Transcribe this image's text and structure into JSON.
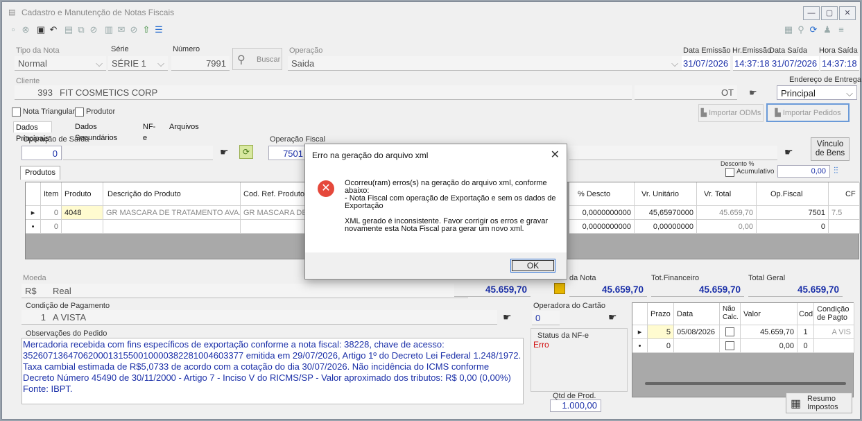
{
  "window": {
    "title": "Cadastro e Manutenção de Notas Fiscais",
    "app_icon": "form-icon"
  },
  "header": {
    "tipo_label": "Tipo da Nota",
    "tipo_value": "Normal",
    "serie_label": "Série",
    "serie_value": "SÉRIE 1",
    "numero_label": "Número",
    "numero_value": "7991",
    "buscar_label": "Buscar",
    "operacao_label": "Operação",
    "operacao_value": "Saida",
    "data_emissao_label": "Data Emissão",
    "data_emissao_value": "31/07/2026",
    "hr_emissao_label": "Hr.Emissão",
    "hr_emissao_value": "14:37:18",
    "data_saida_label": "Data Saída",
    "data_saida_value": "31/07/2026",
    "hora_saida_label": "Hora Saída",
    "hora_saida_value": "14:37:18"
  },
  "cliente": {
    "label": "Cliente",
    "code": "393",
    "name": "FIT COSMETICS CORP",
    "uf": "OT",
    "endereco_label": "Endereço de Entrega",
    "endereco_value": "Principal"
  },
  "checks": {
    "triangular": "Nota Triangular",
    "produtor": "Produtor"
  },
  "import": {
    "odms": "Importar ODMs",
    "pedidos": "Importar Pedidos"
  },
  "tabs": [
    "Dados Principais",
    "Dados Secundários",
    "NF-e",
    "Arquivos"
  ],
  "op_saida": {
    "label": "Operação de Saída",
    "value": "0"
  },
  "op_fiscal": {
    "label": "Operação Fiscal",
    "value": "7501"
  },
  "vinculo": "Vínculo de Bens",
  "desconto": {
    "label": "Desconto %",
    "acumulativo": "Acumulativo",
    "value": "0,00"
  },
  "produtos": {
    "tab": "Produtos",
    "headers": [
      "Item",
      "Produto",
      "Descrição do Produto",
      "Cod. Ref. Produto",
      "% Descto",
      "Vr. Unitário",
      "Vr. Total",
      "Op.Fiscal",
      "CF"
    ],
    "rows": [
      {
        "item": "0",
        "produto": "4048",
        "descricao": "GR MASCARA DE TRATAMENTO AVA...",
        "ref": "GR MASCARA DE T",
        "descto": "0,0000000000",
        "unit": "45,65970000",
        "total": "45.659,70",
        "opf": "7501",
        "cf": "7.5"
      },
      {
        "item": "0",
        "produto": "",
        "descricao": "",
        "ref": "",
        "descto": "0,0000000000",
        "unit": "0,00000000",
        "total": "0,00",
        "opf": "0",
        "cf": ""
      }
    ]
  },
  "moeda": {
    "label": "Moeda",
    "symbol": "R$",
    "name": "Real"
  },
  "totais": {
    "left_value": "45.659,70",
    "nota_label": "da Nota",
    "nota_value": "45.659,70",
    "fin_label": "Tot.Financeiro",
    "fin_value": "45.659,70",
    "geral_label": "Total Geral",
    "geral_value": "45.659,70"
  },
  "pagamento": {
    "label": "Condição de Pagamento",
    "code": "1",
    "name": "A VISTA"
  },
  "operadora": {
    "label": "Operadora do Cartão",
    "value": "0"
  },
  "parcelas": {
    "headers": [
      "Prazo",
      "Data",
      "Não Calc.",
      "Valor",
      "Cod.",
      "Condição de Pagto"
    ],
    "rows": [
      {
        "prazo": "5",
        "data": "05/08/2026",
        "valor": "45.659,70",
        "cod": "1",
        "cond": "A VIS"
      },
      {
        "prazo": "0",
        "data": "",
        "valor": "0,00",
        "cod": "0",
        "cond": ""
      }
    ]
  },
  "observacoes": {
    "label": "Observações do Pedido",
    "text": "Mercadoria recebida com fins específicos de exportação conforme a nota fiscal: 38228, chave de acesso: 35260713647062000131550010000382281004603377 emitida em 29/07/2026, Artigo 1º do Decreto Lei Federal 1.248/1972. Taxa cambial estimada de R$5,0733 de acordo com a cotação do dia 30/07/2026. Não incidência do ICMS conforme Decreto Número 45490 de 30/11/2000 - Artigo 7 - Inciso V do RICMS/SP - Valor aproximado dos tributos: R$ 0,00 (0,00%) Fonte: IBPT."
  },
  "status_nfe": {
    "label": "Status da NF-e",
    "value": "Erro"
  },
  "qtd": {
    "label": "Qtd de Prod.",
    "value": "1.000,00"
  },
  "resumo": "Resumo Impostos",
  "dialog": {
    "title": "Erro na geração do arquivo xml",
    "message": "Ocorreu(ram) erros(s) na geração do arquivo xml, conforme abaixo:\n - Nota Fiscal com operação de Exportação e sem os dados de Exportação\n\nXML gerado é inconsistente. Favor corrigir os erros e gravar novamente esta Nota Fiscal para gerar um novo xml.",
    "ok": "OK",
    "close": "✕"
  },
  "colors": {
    "blue_text": "#1a2fa8",
    "error_red": "#e5483b",
    "status_red": "#d01010"
  }
}
